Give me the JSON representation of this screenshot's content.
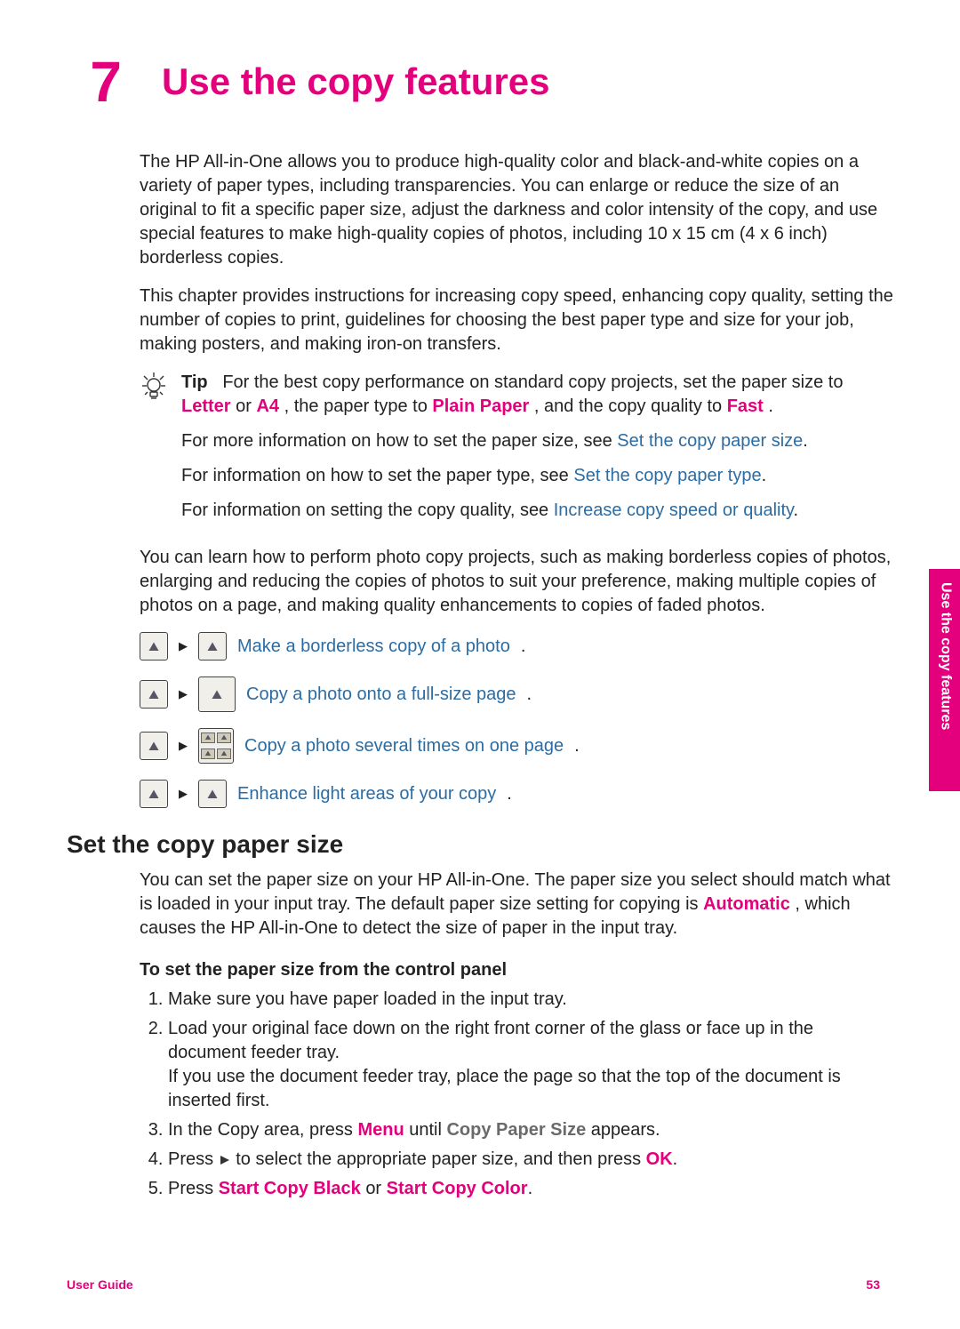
{
  "chapter_number": "7",
  "chapter_title": "Use the copy features",
  "intro_para_1": "The HP All-in-One allows you to produce high-quality color and black-and-white copies on a variety of paper types, including transparencies. You can enlarge or reduce the size of an original to fit a specific paper size, adjust the darkness and color intensity of the copy, and use special features to make high-quality copies of photos, including 10 x 15 cm (4 x 6 inch) borderless copies.",
  "intro_para_2": "This chapter provides instructions for increasing copy speed, enhancing copy quality, setting the number of copies to print, guidelines for choosing the best paper type and size for your job, making posters, and making iron-on transfers.",
  "tip": {
    "label": "Tip",
    "line1_a": "For the best copy performance on standard copy projects, set the paper size to ",
    "letter": "Letter",
    "or": " or ",
    "a4": "A4",
    "line1_b": ", the paper type to ",
    "plain": "Plain Paper",
    "line1_c": ", and the copy quality to ",
    "fast": "Fast",
    "tail": ".",
    "p2_a": "For more information on how to set the paper size, see ",
    "p2_link": "Set the copy paper size",
    "p3_a": "For information on how to set the paper type, see ",
    "p3_link": "Set the copy paper type",
    "p4_a": "For information on setting the copy quality, see ",
    "p4_link": "Increase copy speed or quality"
  },
  "learn_para": "You can learn how to perform photo copy projects, such as making borderless copies of photos, enlarging and reducing the copies of photos to suit your preference, making multiple copies of photos on a page, and making quality enhancements to copies of faded photos.",
  "projects": [
    "Make a borderless copy of a photo",
    "Copy a photo onto a full-size page",
    "Copy a photo several times on one page",
    "Enhance light areas of your copy"
  ],
  "sec_title": "Set the copy paper size",
  "sec_para_a": "You can set the paper size on your HP All-in-One. The paper size you select should match what is loaded in your input tray. The default paper size setting for copying is ",
  "automatic": "Automatic",
  "sec_para_b": ", which causes the HP All-in-One to detect the size of paper in the input tray.",
  "steps_title": "To set the paper size from the control panel",
  "steps": {
    "s1": "Make sure you have paper loaded in the input tray.",
    "s2a": "Load your original face down on the right front corner of the glass or face up in the document feeder tray.",
    "s2b": "If you use the document feeder tray, place the page so that the top of the document is inserted first.",
    "s3a": "In the Copy area, press ",
    "menu": "Menu",
    "s3b": " until ",
    "cps": "Copy Paper Size",
    "s3c": " appears.",
    "s4a": "Press ",
    "s4b": " to select the appropriate paper size, and then press ",
    "ok": "OK",
    "s5a": "Press ",
    "scb": "Start Copy Black",
    "s5or": " or ",
    "scc": "Start Copy Color"
  },
  "side_tab": "Use the copy features",
  "footer_left": "User Guide",
  "footer_right": "53"
}
